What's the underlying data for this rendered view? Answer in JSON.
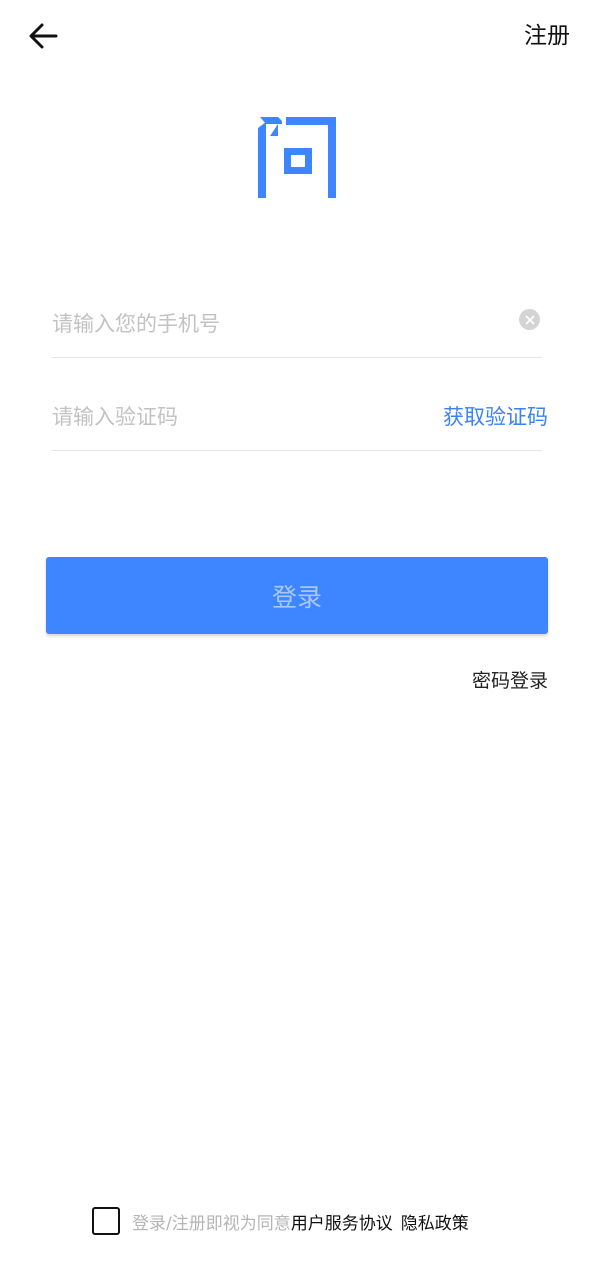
{
  "header": {
    "back_icon": "arrow-left-icon",
    "register_label": "注册"
  },
  "logo": {
    "icon": "wen-logo-icon",
    "color": "#3d86ff"
  },
  "form": {
    "phone_placeholder": "请输入您的手机号",
    "phone_value": "",
    "clear_icon": "clear-circle-icon",
    "code_placeholder": "请输入验证码",
    "code_value": "",
    "get_code_label": "获取验证码"
  },
  "login_button": {
    "label": "登录",
    "color": "#3d86ff"
  },
  "password_login_label": "密码登录",
  "agreement": {
    "checked": false,
    "prefix": "登录/注册即视为同意",
    "terms_label": "用户服务协议",
    "privacy_label": "隐私政策"
  },
  "colors": {
    "accent": "#3d86ff",
    "link": "#3b82f6",
    "placeholder": "#c2c2c2"
  }
}
